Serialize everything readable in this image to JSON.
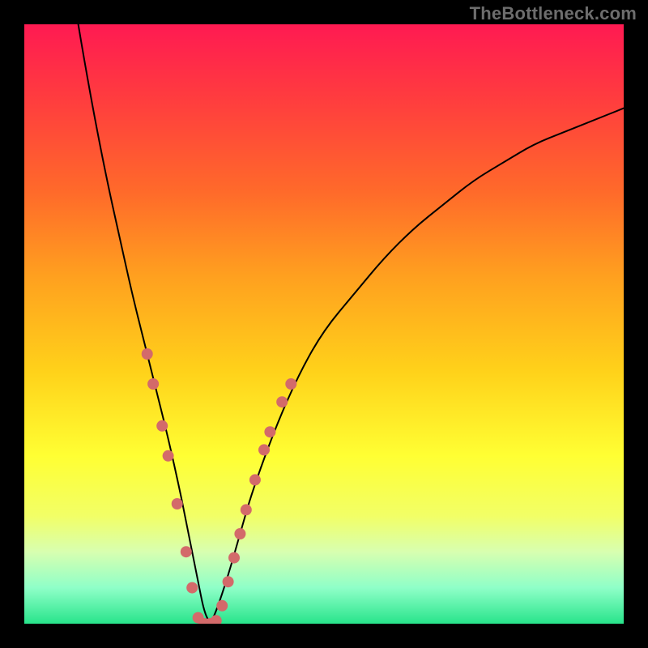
{
  "watermark": "TheBottleneck.com",
  "chart_data": {
    "type": "line",
    "title": "",
    "xlabel": "",
    "ylabel": "",
    "xlim": [
      0,
      100
    ],
    "ylim": [
      0,
      100
    ],
    "series": [
      {
        "name": "curve",
        "x": [
          9,
          10,
          12,
          14,
          16,
          18,
          20,
          22,
          24,
          26,
          27,
          28,
          29,
          30,
          31,
          32,
          34,
          36,
          38,
          42,
          46,
          50,
          55,
          60,
          65,
          70,
          75,
          80,
          85,
          90,
          95,
          100
        ],
        "y": [
          100,
          94,
          83,
          73,
          64,
          55,
          47,
          39,
          31,
          22,
          17,
          12,
          7,
          2,
          0,
          2,
          8,
          15,
          22,
          33,
          42,
          49,
          55,
          61,
          66,
          70,
          74,
          77,
          80,
          82,
          84,
          86
        ]
      }
    ],
    "markers": [
      {
        "x": 20.5,
        "y": 45
      },
      {
        "x": 21.5,
        "y": 40
      },
      {
        "x": 23.0,
        "y": 33
      },
      {
        "x": 24.0,
        "y": 28
      },
      {
        "x": 25.5,
        "y": 20
      },
      {
        "x": 27.0,
        "y": 12
      },
      {
        "x": 28.0,
        "y": 6
      },
      {
        "x": 29.0,
        "y": 1
      },
      {
        "x": 30.0,
        "y": 0
      },
      {
        "x": 31.0,
        "y": 0
      },
      {
        "x": 32.0,
        "y": 0.5
      },
      {
        "x": 33.0,
        "y": 3
      },
      {
        "x": 34.0,
        "y": 7
      },
      {
        "x": 35.0,
        "y": 11
      },
      {
        "x": 36.0,
        "y": 15
      },
      {
        "x": 37.0,
        "y": 19
      },
      {
        "x": 38.5,
        "y": 24
      },
      {
        "x": 40.0,
        "y": 29
      },
      {
        "x": 41.0,
        "y": 32
      },
      {
        "x": 43.0,
        "y": 37
      },
      {
        "x": 44.5,
        "y": 40
      }
    ],
    "marker_color": "#d36a6a",
    "marker_radius_px": 7
  }
}
